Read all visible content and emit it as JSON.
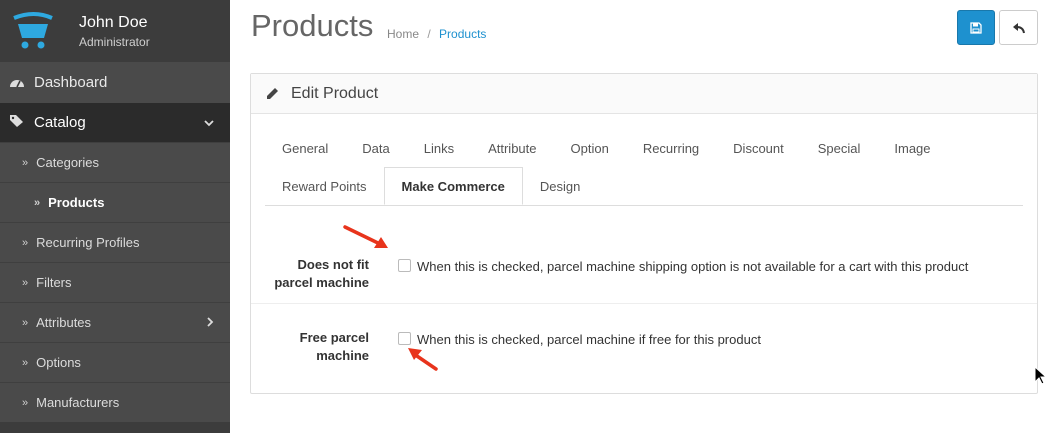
{
  "user": {
    "name": "John Doe",
    "role": "Administrator"
  },
  "sidebar": {
    "dashboard": {
      "label": "Dashboard",
      "icon": "dashboard-icon"
    },
    "catalog": {
      "label": "Catalog",
      "icon": "tags-icon"
    },
    "items": [
      {
        "label": "Categories"
      },
      {
        "label": "Products"
      },
      {
        "label": "Recurring Profiles"
      },
      {
        "label": "Filters"
      },
      {
        "label": "Attributes"
      },
      {
        "label": "Options"
      },
      {
        "label": "Manufacturers"
      }
    ]
  },
  "header": {
    "title": "Products",
    "breadcrumb": {
      "home": "Home",
      "separator": "/",
      "current": "Products"
    }
  },
  "panel": {
    "title": "Edit Product",
    "tabs_row1": [
      "General",
      "Data",
      "Links",
      "Attribute",
      "Option",
      "Recurring",
      "Discount",
      "Special",
      "Image"
    ],
    "tabs_row2": [
      "Reward Points",
      "Make Commerce",
      "Design"
    ],
    "active_tab": "Make Commerce"
  },
  "form": {
    "row1": {
      "label_line1": "Does not fit",
      "label_line2": "parcel machine",
      "checked": false,
      "help": "When this is checked, parcel machine shipping option is not available for a cart with this product"
    },
    "row2": {
      "label_line1": "Free parcel",
      "label_line2": "machine",
      "checked": false,
      "help": "When this is checked, parcel machine if free for this product"
    }
  },
  "colors": {
    "sidebar_bg": "#3c3c3c",
    "accent": "#1e91cf",
    "annotation_arrow": "#e8341c"
  }
}
